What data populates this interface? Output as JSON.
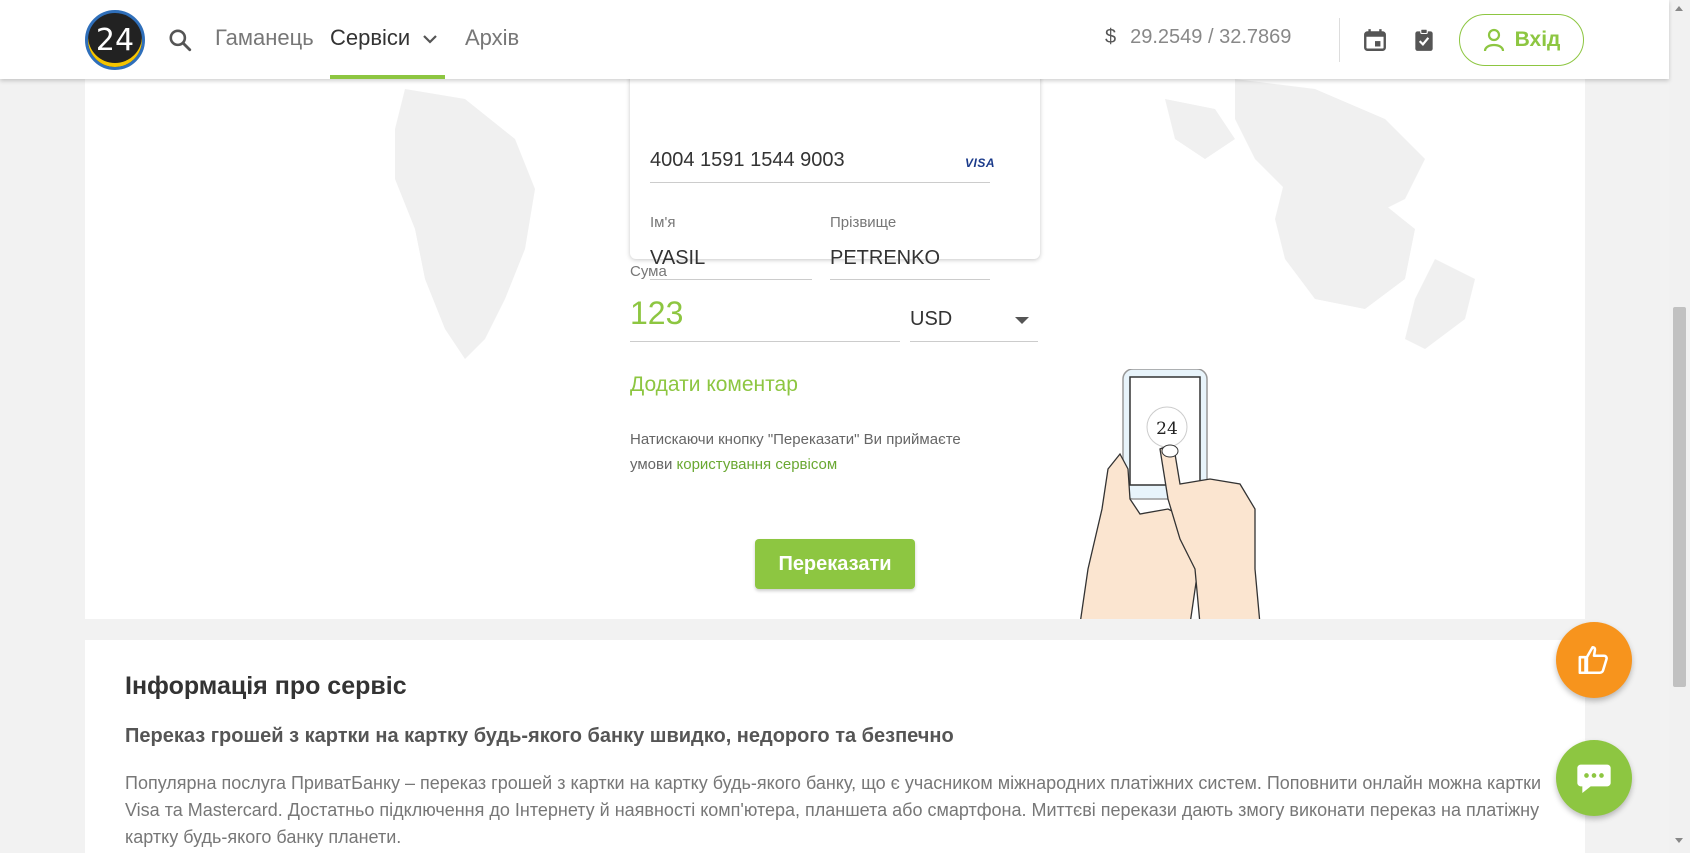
{
  "header": {
    "logo_text": "24",
    "nav": [
      {
        "label": "Гаманець"
      },
      {
        "label": "Сервіси"
      },
      {
        "label": "Архів"
      }
    ],
    "rate_currency": "$",
    "rate_value": "29.2549 / 32.7869",
    "login_label": "Вхід"
  },
  "card": {
    "number": "4004 1591 1544 9003",
    "brand": "VISA",
    "first_name_label": "Ім'я",
    "first_name": "VASIL",
    "last_name_label": "Прізвище",
    "last_name": "PETRENKO"
  },
  "amount": {
    "label": "Сума",
    "value": "123",
    "currency": "USD"
  },
  "add_comment": "Додати коментар",
  "terms": {
    "text": "Натискаючи кнопку \"Переказати\" Ви приймаєте умови ",
    "link": "користування сервісом"
  },
  "submit_label": "Переказати",
  "illustration_logo": "24",
  "info": {
    "title": "Інформація про сервіс",
    "subtitle": "Переказ грошей з картки на картку будь-якого банку швидко, недорого та безпечно",
    "text": "Популярна послуга ПриватБанку – переказ грошей з картки на картку будь-якого банку, що є учасником міжнародних платіжних систем. Поповнити онлайн можна картки Visa та Mastercard. Достатньо підключення до Інтернету й наявності комп'ютера, планшета або смартфона. Миттєві перекази дають змогу виконати переказ на платіжну картку будь-якого банку планети."
  },
  "colors": {
    "accent": "#8dc641",
    "orange": "#f7941d"
  }
}
